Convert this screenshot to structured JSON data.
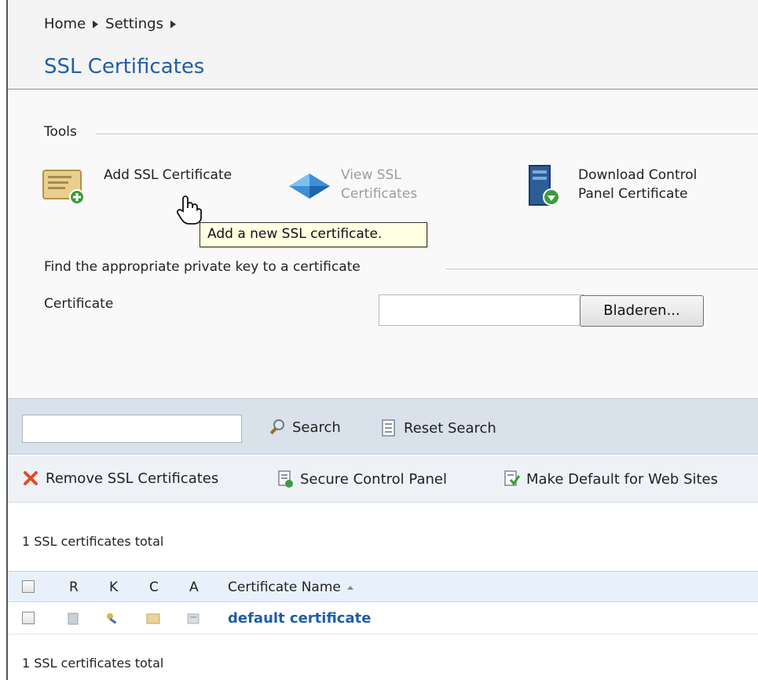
{
  "breadcrumb": {
    "items": [
      "Home",
      "Settings"
    ]
  },
  "page": {
    "title": "SSL Certificates"
  },
  "tools": {
    "section_title": "Tools",
    "add_ssl": "Add SSL Certificate",
    "view_ssl_line1": "View SSL",
    "view_ssl_line2": "Certificates",
    "download_line1": "Download Control",
    "download_line2": "Panel Certificate",
    "tooltip": "Add a new SSL certificate."
  },
  "find_key": {
    "section_title": "Find the appropriate private key to a certificate",
    "certificate_label": "Certificate",
    "file_value": "",
    "browse_button": "Bladeren..."
  },
  "search": {
    "input_value": "",
    "search_label": "Search",
    "reset_label": "Reset Search"
  },
  "actions": {
    "remove": "Remove SSL Certificates",
    "secure": "Secure Control Panel",
    "make_default": "Make Default for Web Sites"
  },
  "summary": {
    "total_top": "1 SSL certificates total",
    "total_bottom": "1 SSL certificates total"
  },
  "grid": {
    "columns": [
      "R",
      "K",
      "C",
      "A",
      "Certificate Name"
    ],
    "rows": [
      {
        "name": "default certificate"
      }
    ]
  },
  "colors": {
    "title": "#1f5fa6",
    "link": "#1f5fa6",
    "toolbar_bg": "#d9e1eb",
    "tooltip_bg": "#ffffe1"
  },
  "icons": [
    "certificate-add-icon",
    "ssl-gem-icon",
    "server-download-icon",
    "hand-cursor-icon",
    "magnifier-icon",
    "reset-icon",
    "remove-x-icon",
    "secure-icon",
    "make-default-icon"
  ]
}
